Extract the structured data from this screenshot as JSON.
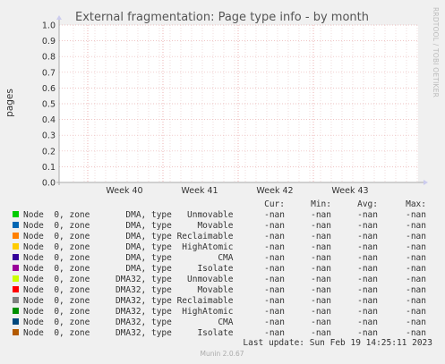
{
  "chart_data": {
    "type": "line",
    "title": "External fragmentation: Page type info - by month",
    "ylabel": "pages",
    "ylim": [
      0,
      1
    ],
    "yticks": [
      "0.0",
      "0.1",
      "0.2",
      "0.3",
      "0.4",
      "0.5",
      "0.6",
      "0.7",
      "0.8",
      "0.9",
      "1.0"
    ],
    "xticks": [
      "Week 40",
      "Week 41",
      "Week 42",
      "Week 43"
    ],
    "grid": true,
    "series": [],
    "legend": {
      "headers": [
        "Cur:",
        "Min:",
        "Avg:",
        "Max:"
      ],
      "entries": [
        {
          "label": "Node  0, zone       DMA, type   Unmovable",
          "color": "#00cc00",
          "cur": "-nan",
          "min": "-nan",
          "avg": "-nan",
          "max": "-nan"
        },
        {
          "label": "Node  0, zone       DMA, type     Movable",
          "color": "#0066b3",
          "cur": "-nan",
          "min": "-nan",
          "avg": "-nan",
          "max": "-nan"
        },
        {
          "label": "Node  0, zone       DMA, type Reclaimable",
          "color": "#ff8000",
          "cur": "-nan",
          "min": "-nan",
          "avg": "-nan",
          "max": "-nan"
        },
        {
          "label": "Node  0, zone       DMA, type  HighAtomic",
          "color": "#ffcc00",
          "cur": "-nan",
          "min": "-nan",
          "avg": "-nan",
          "max": "-nan"
        },
        {
          "label": "Node  0, zone       DMA, type         CMA",
          "color": "#330099",
          "cur": "-nan",
          "min": "-nan",
          "avg": "-nan",
          "max": "-nan"
        },
        {
          "label": "Node  0, zone       DMA, type     Isolate",
          "color": "#990099",
          "cur": "-nan",
          "min": "-nan",
          "avg": "-nan",
          "max": "-nan"
        },
        {
          "label": "Node  0, zone     DMA32, type   Unmovable",
          "color": "#ccff00",
          "cur": "-nan",
          "min": "-nan",
          "avg": "-nan",
          "max": "-nan"
        },
        {
          "label": "Node  0, zone     DMA32, type     Movable",
          "color": "#ff0000",
          "cur": "-nan",
          "min": "-nan",
          "avg": "-nan",
          "max": "-nan"
        },
        {
          "label": "Node  0, zone     DMA32, type Reclaimable",
          "color": "#808080",
          "cur": "-nan",
          "min": "-nan",
          "avg": "-nan",
          "max": "-nan"
        },
        {
          "label": "Node  0, zone     DMA32, type  HighAtomic",
          "color": "#008f00",
          "cur": "-nan",
          "min": "-nan",
          "avg": "-nan",
          "max": "-nan"
        },
        {
          "label": "Node  0, zone     DMA32, type         CMA",
          "color": "#00487d",
          "cur": "-nan",
          "min": "-nan",
          "avg": "-nan",
          "max": "-nan"
        },
        {
          "label": "Node  0, zone     DMA32, type     Isolate",
          "color": "#b35a00",
          "cur": "-nan",
          "min": "-nan",
          "avg": "-nan",
          "max": "-nan"
        }
      ]
    }
  },
  "last_update": "Last update: Sun Feb 19 14:25:11 2023",
  "side_label": "RRDTOOL / TOBI OETIKER",
  "footer": "Munin 2.0.67"
}
